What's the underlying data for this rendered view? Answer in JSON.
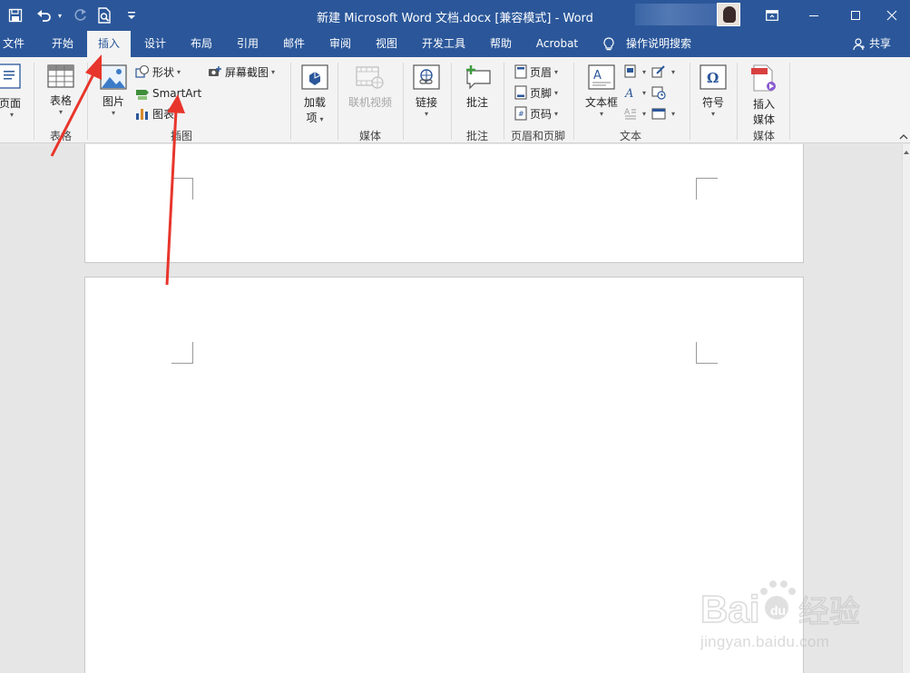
{
  "title_bar": {
    "document_title": "新建 Microsoft Word 文档.docx [兼容模式]",
    "separator": " - ",
    "app_name": "Word",
    "icons": [
      "save-icon",
      "undo-icon",
      "redo-icon",
      "print-preview-icon",
      "customize-qat-icon",
      "ribbon-display-options-icon",
      "minimize-icon",
      "maximize-icon",
      "close-icon"
    ]
  },
  "tabs": [
    {
      "label": "文件"
    },
    {
      "label": "开始"
    },
    {
      "label": "插入",
      "active": true
    },
    {
      "label": "设计"
    },
    {
      "label": "布局"
    },
    {
      "label": "引用"
    },
    {
      "label": "邮件"
    },
    {
      "label": "审阅"
    },
    {
      "label": "视图"
    },
    {
      "label": "开发工具"
    },
    {
      "label": "帮助"
    },
    {
      "label": "Acrobat"
    }
  ],
  "tell_me": "操作说明搜索",
  "share": "共享",
  "ribbon": {
    "pages": {
      "button": "页面",
      "dropdown": "▾"
    },
    "tables": {
      "button": "表格",
      "group_label": "表格"
    },
    "illustrations": {
      "pictures": "图片",
      "shapes": "形状",
      "smartart": "SmartArt",
      "chart": "图表",
      "screenshot": "屏幕截图",
      "group_label": "插图"
    },
    "addins": {
      "button_line1": "加载",
      "button_line2": "项"
    },
    "media": {
      "online_video": "联机视频",
      "group_label": "媒体"
    },
    "links": {
      "button": "链接"
    },
    "comments": {
      "button": "批注",
      "group_label": "批注"
    },
    "header_footer": {
      "header": "页眉",
      "footer": "页脚",
      "page_number": "页码",
      "group_label": "页眉和页脚"
    },
    "text": {
      "textbox": "文本框",
      "group_label": "文本"
    },
    "symbols": {
      "button": "符号"
    },
    "media2": {
      "button_line1": "插入",
      "button_line2": "媒体",
      "group_label": "媒体"
    }
  },
  "accent_color": "#2b579a",
  "arrow_color": "#e8352b",
  "watermark": {
    "brand": "Baidu经验",
    "url": "jingyan.baidu.com"
  }
}
